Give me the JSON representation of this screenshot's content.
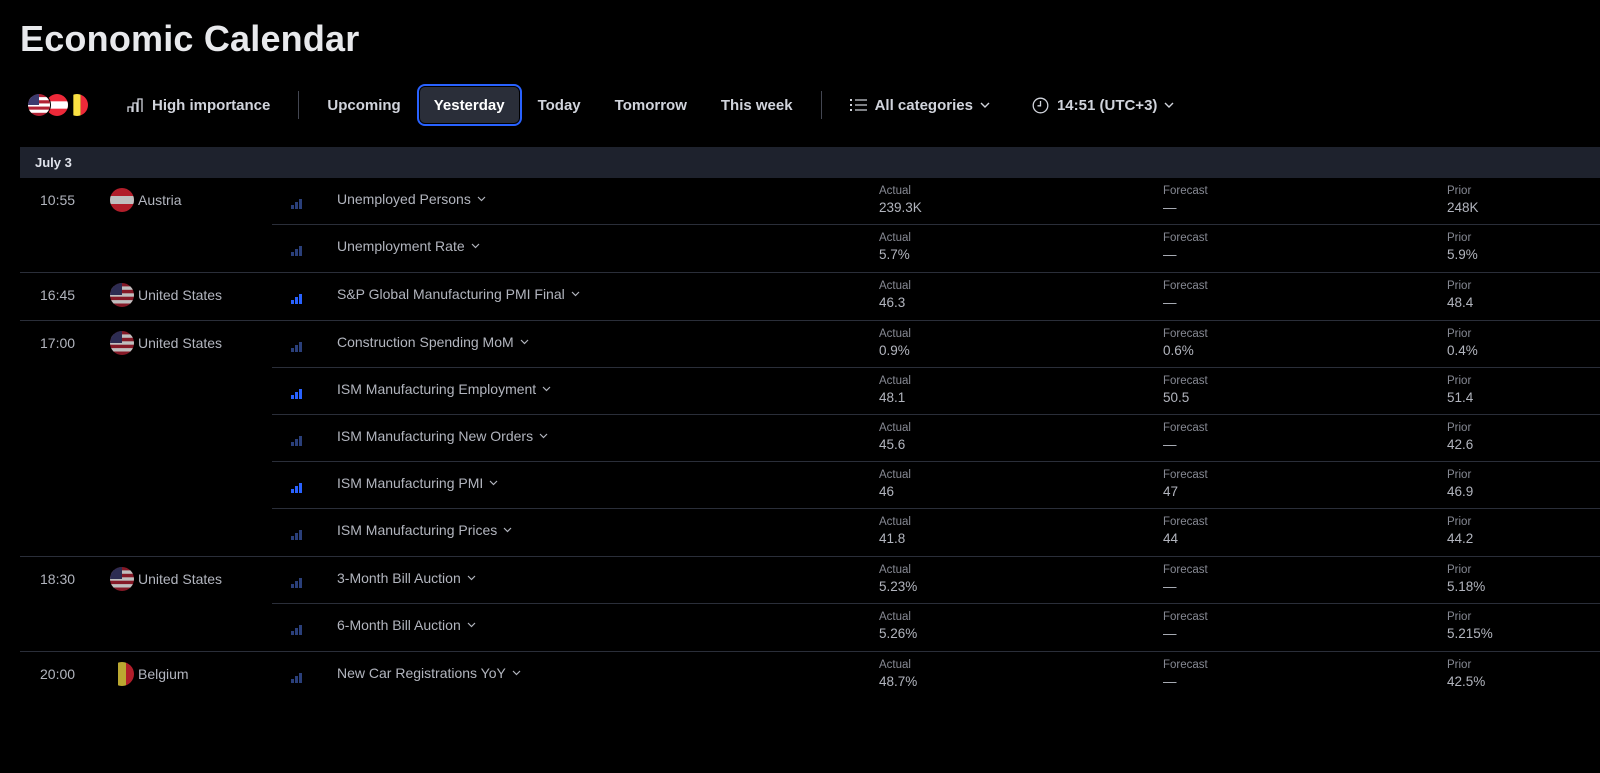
{
  "page_title": "Economic Calendar",
  "toolbar": {
    "importance_label": "High importance",
    "tabs": [
      "Upcoming",
      "Yesterday",
      "Today",
      "Tomorrow",
      "This week"
    ],
    "active_tab": "Yesterday",
    "categories_label": "All categories",
    "timezone_label": "14:51 (UTC+3)"
  },
  "colors": {
    "accent": "#2962ff",
    "background": "#000000",
    "date_bar": "#1e222d",
    "importance_high": "#2962ff",
    "importance_low": "#2a3f7a"
  },
  "labels": {
    "actual": "Actual",
    "forecast": "Forecast",
    "prior": "Prior"
  },
  "date_label": "July 3",
  "groups": [
    {
      "time": "10:55",
      "country": "Austria",
      "flag": "austria-flag-icon",
      "events": [
        {
          "name": "Unemployed Persons",
          "actual": "239.3K",
          "forecast": "—",
          "prior": "248K",
          "importance": "low"
        },
        {
          "name": "Unemployment Rate",
          "actual": "5.7%",
          "forecast": "—",
          "prior": "5.9%",
          "importance": "low"
        }
      ]
    },
    {
      "time": "16:45",
      "country": "United States",
      "flag": "us-flag-icon",
      "events": [
        {
          "name": "S&P Global Manufacturing PMI Final",
          "actual": "46.3",
          "forecast": "—",
          "prior": "48.4",
          "importance": "high"
        }
      ]
    },
    {
      "time": "17:00",
      "country": "United States",
      "flag": "us-flag-icon",
      "events": [
        {
          "name": "Construction Spending MoM",
          "actual": "0.9%",
          "forecast": "0.6%",
          "prior": "0.4%",
          "importance": "low"
        },
        {
          "name": "ISM Manufacturing Employment",
          "actual": "48.1",
          "forecast": "50.5",
          "prior": "51.4",
          "importance": "high"
        },
        {
          "name": "ISM Manufacturing New Orders",
          "actual": "45.6",
          "forecast": "—",
          "prior": "42.6",
          "importance": "low"
        },
        {
          "name": "ISM Manufacturing PMI",
          "actual": "46",
          "forecast": "47",
          "prior": "46.9",
          "importance": "high"
        },
        {
          "name": "ISM Manufacturing Prices",
          "actual": "41.8",
          "forecast": "44",
          "prior": "44.2",
          "importance": "low"
        }
      ]
    },
    {
      "time": "18:30",
      "country": "United States",
      "flag": "us-flag-icon",
      "events": [
        {
          "name": "3-Month Bill Auction",
          "actual": "5.23%",
          "forecast": "—",
          "prior": "5.18%",
          "importance": "low"
        },
        {
          "name": "6-Month Bill Auction",
          "actual": "5.26%",
          "forecast": "—",
          "prior": "5.215%",
          "importance": "low"
        }
      ]
    },
    {
      "time": "20:00",
      "country": "Belgium",
      "flag": "belgium-flag-icon",
      "events": [
        {
          "name": "New Car Registrations YoY",
          "actual": "48.7%",
          "forecast": "—",
          "prior": "42.5%",
          "importance": "low"
        }
      ]
    }
  ]
}
